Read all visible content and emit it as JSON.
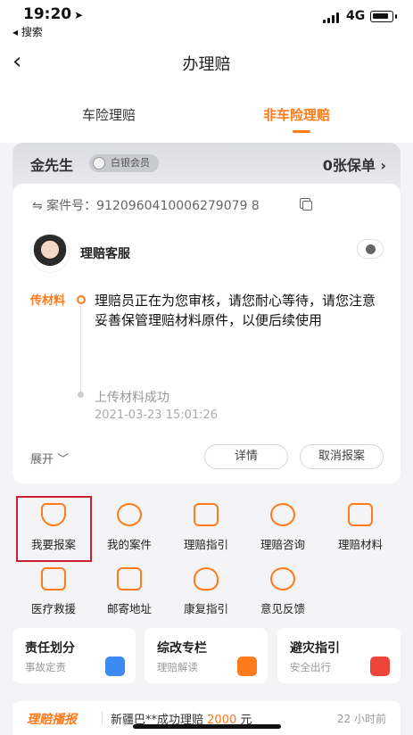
{
  "status_bar": {
    "time": "19:20",
    "location_glyph": "➤",
    "back_app": "◂ 搜索",
    "network": "4G"
  },
  "navbar": {
    "back_glyph": "‹",
    "title": "办理赔"
  },
  "tabs": [
    {
      "label": "车险理赔"
    },
    {
      "label": "非车险理赔"
    }
  ],
  "member": {
    "name": "金先生",
    "level": "白银会员",
    "policy_count": "0张保单 ›"
  },
  "claim": {
    "case_number": "⇋ 案件号：9120960410006279079 8",
    "agent": "理赔客服",
    "timeline": [
      {
        "label": "传材料",
        "text": "理赔员正在为您审核，请您耐心等待，请您注意妥善保管理赔材料原件，以便后续使用"
      },
      {
        "text": "上传材料成功",
        "time": "2021-03-23 15:01:26"
      }
    ],
    "expand": "展开 ﹀",
    "detail_button": "详情",
    "cancel_button": "取消报案"
  },
  "grid": [
    {
      "label": "我要报案",
      "icon": "shield-plus-icon"
    },
    {
      "label": "我的案件",
      "icon": "search-doc-icon"
    },
    {
      "label": "理赔指引",
      "icon": "edit-doc-icon"
    },
    {
      "label": "理赔咨询",
      "icon": "user-icon"
    },
    {
      "label": "理赔材料",
      "icon": "book-icon"
    },
    {
      "label": "医疗救援",
      "icon": "medical-kit-icon"
    },
    {
      "label": "邮寄地址",
      "icon": "mailbox-icon"
    },
    {
      "label": "康复指引",
      "icon": "heart-icon"
    },
    {
      "label": "意见反馈",
      "icon": "feedback-icon"
    }
  ],
  "cards": [
    {
      "title": "责任划分",
      "sub": "事故定责",
      "color": "#3d8bf2"
    },
    {
      "title": "综改专栏",
      "sub": "理赔解读",
      "color": "#ff7a1a"
    },
    {
      "title": "避灾指引",
      "sub": "安全出行",
      "color": "#f0453a"
    }
  ],
  "ticker": {
    "label": "理赔播报",
    "text": "新疆巴**成功理赔 ",
    "amount": "2000",
    "unit": " 元",
    "time": "22 小时前"
  },
  "colors": {
    "accent": "#ff7a1a",
    "highlight": "#c8202d"
  }
}
